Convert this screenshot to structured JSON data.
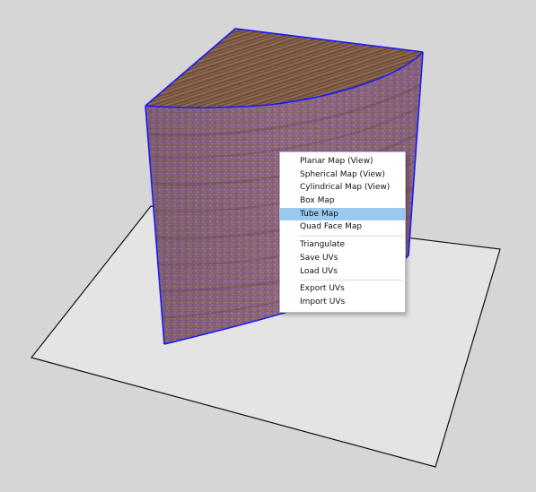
{
  "viewport": {
    "background": "#d6d6d6"
  },
  "scene": {
    "model": "quarter-cylinder-wedge",
    "texture": "brick-woodgrain",
    "edge_color": "#1a1aff",
    "ground_color": "#e4e4e4"
  },
  "context_menu": {
    "accent": "#99c9ef",
    "groups": [
      {
        "items": [
          {
            "label": "Planar Map (View)",
            "active": false
          },
          {
            "label": "Spherical Map (View)",
            "active": false
          },
          {
            "label": "Cylindrical Map (View)",
            "active": false
          },
          {
            "label": "Box Map",
            "active": false
          },
          {
            "label": "Tube Map",
            "active": true
          },
          {
            "label": "Quad Face Map",
            "active": false
          }
        ]
      },
      {
        "items": [
          {
            "label": "Triangulate",
            "active": false
          },
          {
            "label": "Save UVs",
            "active": false
          },
          {
            "label": "Load UVs",
            "active": false
          }
        ]
      },
      {
        "items": [
          {
            "label": "Export UVs",
            "active": false
          },
          {
            "label": "Import UVs",
            "active": false
          }
        ]
      }
    ]
  }
}
